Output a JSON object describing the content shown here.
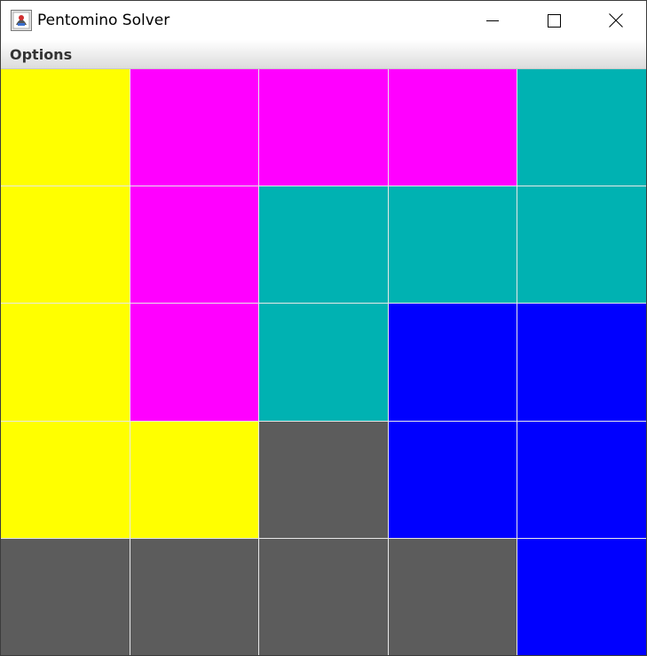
{
  "window": {
    "title": "Pentomino Solver"
  },
  "menu": {
    "items": [
      "Options"
    ]
  },
  "board": {
    "rows": 5,
    "cols": 5,
    "colors": {
      "Y": "#ffff00",
      "M": "#ff00ff",
      "T": "#00b2b2",
      "B": "#0000ff",
      "G": "#5c5c5c"
    },
    "cells": [
      [
        "Y",
        "M",
        "M",
        "M",
        "T"
      ],
      [
        "Y",
        "M",
        "T",
        "T",
        "T"
      ],
      [
        "Y",
        "M",
        "T",
        "B",
        "B"
      ],
      [
        "Y",
        "Y",
        "G",
        "B",
        "B"
      ],
      [
        "G",
        "G",
        "G",
        "G",
        "B"
      ]
    ]
  }
}
